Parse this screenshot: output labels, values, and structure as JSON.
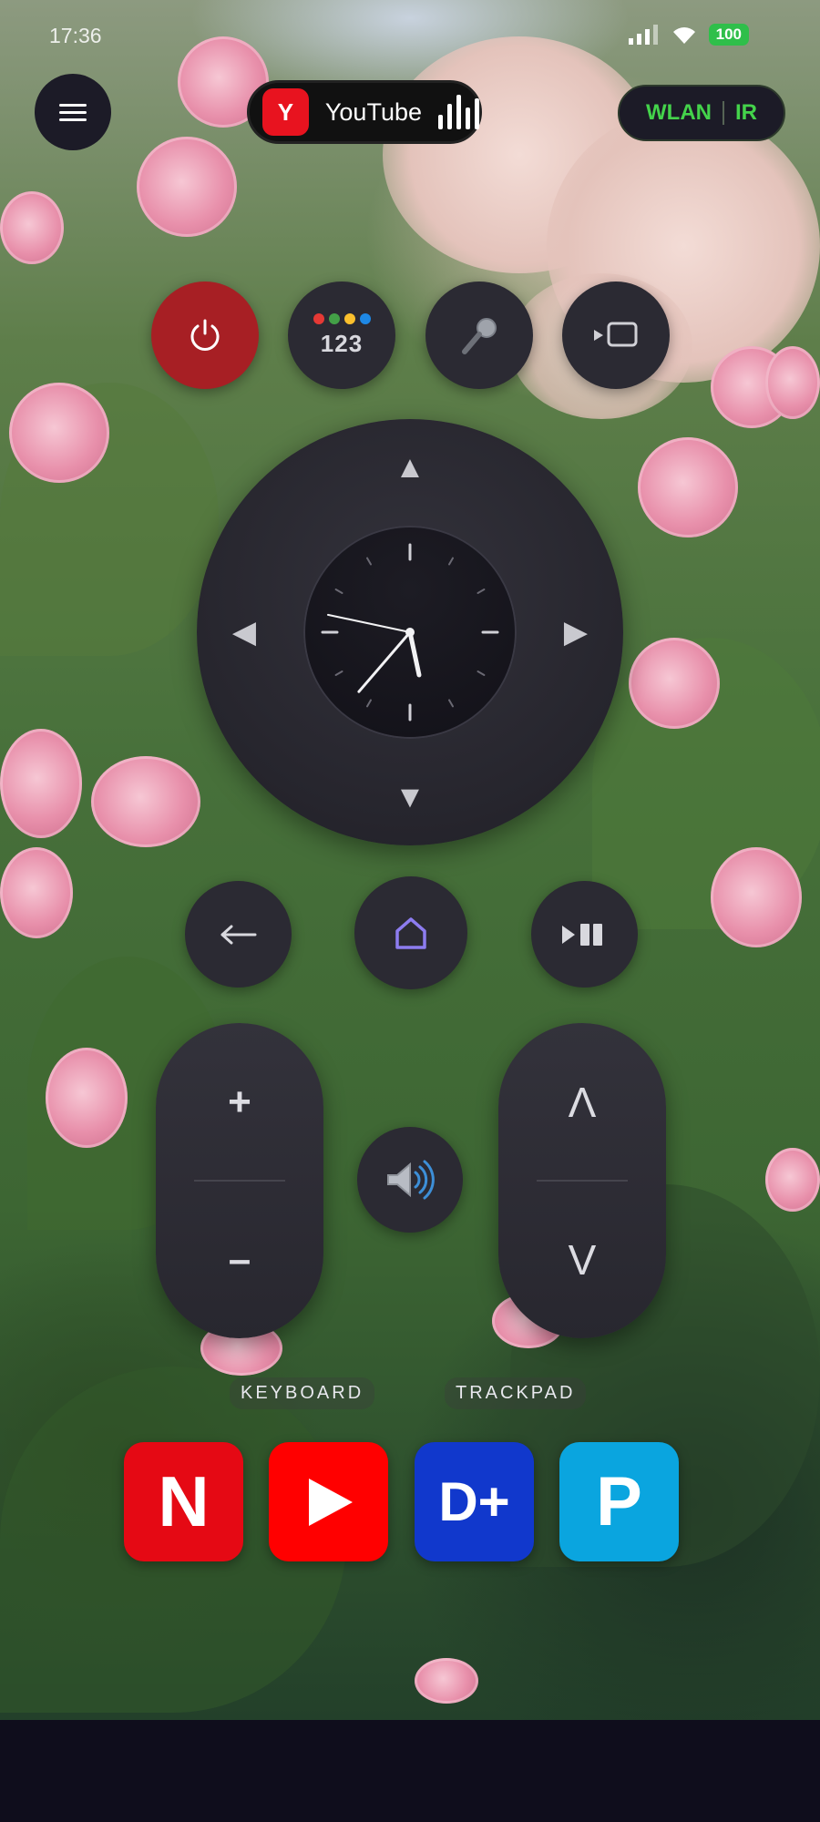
{
  "status_bar": {
    "time": "17:36",
    "battery": "100"
  },
  "header": {
    "menu_icon": "hamburger-menu-icon",
    "current_app": {
      "badge": "Y",
      "name": "YouTube",
      "badge_color": "#e8131f"
    },
    "connection": {
      "wlan": "WLAN",
      "ir": "IR",
      "accent": "#44d34b"
    }
  },
  "quick_buttons": {
    "power_icon": "power-icon",
    "power_color": "#a71f24",
    "numpad_label": "123",
    "numpad_dot_colors": [
      "#e53935",
      "#43a047",
      "#fbc02d",
      "#1e88e5"
    ],
    "mic_icon": "microphone-icon",
    "input_icon": "input-source-icon"
  },
  "dpad": {
    "up": "▲",
    "down": "▼",
    "left": "◀",
    "right": "▶",
    "clock": {
      "hour": 5,
      "minute": 36,
      "second": 47
    }
  },
  "controls": {
    "back_icon": "back-arrow-icon",
    "home_icon": "home-icon",
    "home_color": "#8d7cf0",
    "play_pause_icon": "play-pause-icon"
  },
  "volume": {
    "up": "+",
    "down": "–"
  },
  "channel": {
    "up": "Λ",
    "down": "V"
  },
  "sound_icon": "speaker-icon",
  "modes": {
    "keyboard": "KEYBOARD",
    "trackpad": "TRACKPAD"
  },
  "streaming_apps": [
    {
      "label": "N",
      "color": "#e50914",
      "icon": "netflix-icon"
    },
    {
      "label": "",
      "color": "#ff0000",
      "icon": "youtube-play-icon"
    },
    {
      "label": "D+",
      "color": "#1138cc",
      "icon": "disney-plus-icon"
    },
    {
      "label": "P",
      "color": "#0aa5df",
      "icon": "prime-video-icon"
    }
  ]
}
